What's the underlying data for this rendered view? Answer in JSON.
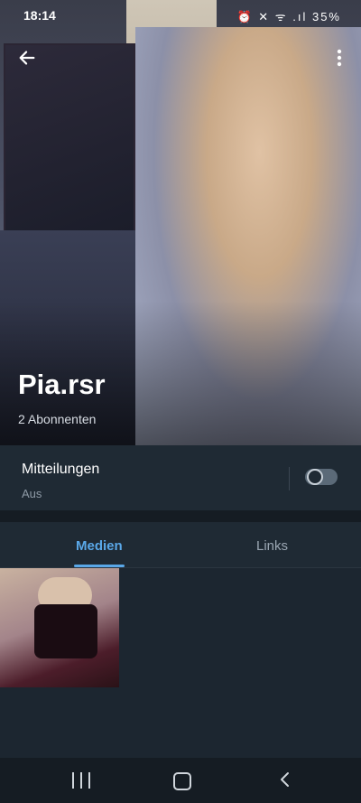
{
  "status_bar": {
    "time": "18:14",
    "icons_text": "⏰ ✕ ᯤ .ıl 35%"
  },
  "profile": {
    "name": "Pia.rsr",
    "subscribers": "2 Abonnenten"
  },
  "notifications": {
    "title": "Mitteilungen",
    "state": "Aus",
    "toggle_on": false
  },
  "tabs": [
    {
      "label": "Medien",
      "active": true
    },
    {
      "label": "Links",
      "active": false
    }
  ],
  "colors": {
    "accent": "#5aa8e8",
    "background": "#1c2630"
  }
}
